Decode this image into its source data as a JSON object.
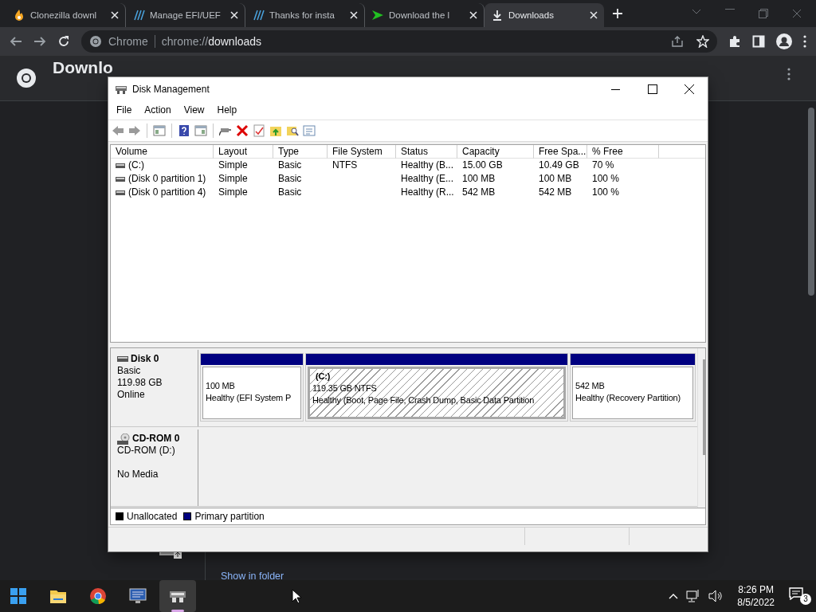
{
  "browser": {
    "tabs": [
      {
        "title": "Clonezilla downl",
        "selected": false
      },
      {
        "title": "Manage EFI/UEF",
        "selected": false
      },
      {
        "title": "Thanks for insta",
        "selected": false
      },
      {
        "title": "Download the l",
        "selected": false
      },
      {
        "title": "Downloads",
        "selected": true
      }
    ],
    "address": {
      "origin": "Chrome",
      "url_prefix": "chrome://",
      "url_host": "downloads"
    },
    "heading": "Downlo",
    "show_in_folder": "Show in folder"
  },
  "window": {
    "title": "Disk Management",
    "menu": [
      "File",
      "Action",
      "View",
      "Help"
    ],
    "volume_table": {
      "columns": [
        "Volume",
        "Layout",
        "Type",
        "File System",
        "Status",
        "Capacity",
        "Free Spa...",
        "% Free"
      ],
      "rows": [
        [
          "(C:)",
          "Simple",
          "Basic",
          "NTFS",
          "Healthy (B...",
          "15.00 GB",
          "10.49 GB",
          "70 %"
        ],
        [
          "(Disk 0 partition 1)",
          "Simple",
          "Basic",
          "",
          "Healthy (E...",
          "100 MB",
          "100 MB",
          "100 %"
        ],
        [
          "(Disk 0 partition 4)",
          "Simple",
          "Basic",
          "",
          "Healthy (R...",
          "542 MB",
          "542 MB",
          "100 %"
        ]
      ]
    },
    "disks": [
      {
        "kind": "disk",
        "name": "Disk 0",
        "type": "Basic",
        "size": "119.98 GB",
        "status": "Online",
        "partitions": [
          {
            "size": "100 MB",
            "status": "Healthy (EFI System P",
            "selected": false
          },
          {
            "label": "(C:)",
            "size": "119.35 GB NTFS",
            "status": "Healthy (Boot, Page File, Crash Dump, Basic Data Partition",
            "selected": true
          },
          {
            "size": "542 MB",
            "status": "Healthy (Recovery Partition)",
            "selected": false
          }
        ]
      },
      {
        "kind": "cdrom",
        "name": "CD-ROM 0",
        "type": "CD-ROM (D:)",
        "status": "No Media"
      }
    ],
    "legend": [
      {
        "label": "Unallocated",
        "color": "#000000"
      },
      {
        "label": "Primary partition",
        "color": "#000080"
      }
    ]
  },
  "taskbar": {
    "apps": [
      {
        "kind": "start",
        "selected": false
      },
      {
        "kind": "folder",
        "selected": false
      },
      {
        "kind": "chrome",
        "selected": false
      },
      {
        "kind": "monitor",
        "selected": false
      },
      {
        "kind": "disk",
        "selected": true
      }
    ],
    "time": "8:26 PM",
    "date": "8/5/2022",
    "notifications": "3"
  }
}
